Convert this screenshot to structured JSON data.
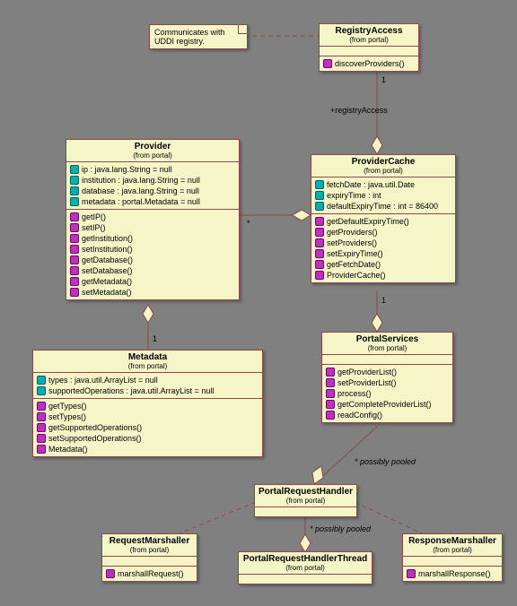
{
  "note": {
    "line1": "Communicates with",
    "line2": "UDDI registry."
  },
  "registryAccess": {
    "name": "RegistryAccess",
    "from": "(from portal)",
    "ops": [
      "discoverProviders()"
    ]
  },
  "provider": {
    "name": "Provider",
    "from": "(from portal)",
    "attrs": [
      "ip : java.lang.String = null",
      "institution : java.lang.String = null",
      "database : java.lang.String = null",
      "metadata : portal.Metadata = null"
    ],
    "ops": [
      "getIP()",
      "setIP()",
      "getInstitution()",
      "setInstitution()",
      "getDatabase()",
      "setDatabase()",
      "getMetadata()",
      "setMetadata()"
    ]
  },
  "providerCache": {
    "name": "ProviderCache",
    "from": "(from portal)",
    "attrs": [
      "fetchDate : java.util.Date",
      "expiryTime : int",
      "defaultExpiryTime : int = 86400"
    ],
    "ops": [
      "getDefaultExpiryTime()",
      "getProviders()",
      "setProviders()",
      "setExpiryTime()",
      "getFetchDate()",
      "ProviderCache()"
    ]
  },
  "metadata": {
    "name": "Metadata",
    "from": "(from portal)",
    "attrs": [
      "types : java.util.ArrayList = null",
      "supportedOperations : java.util.ArrayList = null"
    ],
    "ops": [
      "getTypes()",
      "setTypes()",
      "getSupportedOperations()",
      "setSupportedOperations()",
      "Metadata()"
    ]
  },
  "portalServices": {
    "name": "PortalServices",
    "from": "(from portal)",
    "ops": [
      "getProviderList()",
      "setProviderList()",
      "process()",
      "getCompleteProviderList()",
      "readConfig()"
    ]
  },
  "portalRequestHandler": {
    "name": "PortalRequestHandler",
    "from": "(from portal)"
  },
  "requestMarshaller": {
    "name": "RequestMarshaller",
    "from": "(from portal)",
    "ops": [
      "marshallRequest()"
    ]
  },
  "responseMarshaller": {
    "name": "ResponseMarshaller",
    "from": "(from portal)",
    "ops": [
      "marshallResponse()"
    ]
  },
  "portalRequestHandlerThread": {
    "name": "PortalRequestHandlerThread",
    "from": "(from portal)"
  },
  "labels": {
    "registryAccess": "+registryAccess",
    "one_a": "1",
    "star": "*",
    "one_b": "1",
    "one_c": "1",
    "pooled1": "*  possibly pooled",
    "pooled2": "*  possibly pooled"
  },
  "chart_data": {
    "type": "table",
    "title": "UML Class Diagram — portal package",
    "classes": [
      {
        "name": "RegistryAccess",
        "package": "portal",
        "operations": [
          "discoverProviders()"
        ]
      },
      {
        "name": "Provider",
        "package": "portal",
        "attributes": [
          "ip : java.lang.String = null",
          "institution : java.lang.String = null",
          "database : java.lang.String = null",
          "metadata : portal.Metadata = null"
        ],
        "operations": [
          "getIP()",
          "setIP()",
          "getInstitution()",
          "setInstitution()",
          "getDatabase()",
          "setDatabase()",
          "getMetadata()",
          "setMetadata()"
        ]
      },
      {
        "name": "ProviderCache",
        "package": "portal",
        "attributes": [
          "fetchDate : java.util.Date",
          "expiryTime : int",
          "defaultExpiryTime : int = 86400"
        ],
        "operations": [
          "getDefaultExpiryTime()",
          "getProviders()",
          "setProviders()",
          "setExpiryTime()",
          "getFetchDate()",
          "ProviderCache()"
        ]
      },
      {
        "name": "Metadata",
        "package": "portal",
        "attributes": [
          "types : java.util.ArrayList = null",
          "supportedOperations : java.util.ArrayList = null"
        ],
        "operations": [
          "getTypes()",
          "setTypes()",
          "getSupportedOperations()",
          "setSupportedOperations()",
          "Metadata()"
        ]
      },
      {
        "name": "PortalServices",
        "package": "portal",
        "operations": [
          "getProviderList()",
          "setProviderList()",
          "process()",
          "getCompleteProviderList()",
          "readConfig()"
        ]
      },
      {
        "name": "PortalRequestHandler",
        "package": "portal"
      },
      {
        "name": "RequestMarshaller",
        "package": "portal",
        "operations": [
          "marshallRequest()"
        ]
      },
      {
        "name": "ResponseMarshaller",
        "package": "portal",
        "operations": [
          "marshallResponse()"
        ]
      },
      {
        "name": "PortalRequestHandlerThread",
        "package": "portal"
      }
    ],
    "relationships": [
      {
        "from": "note",
        "to": "RegistryAccess",
        "type": "note-anchor"
      },
      {
        "from": "ProviderCache",
        "to": "RegistryAccess",
        "type": "aggregation",
        "role": "+registryAccess",
        "multiplicity": "1"
      },
      {
        "from": "ProviderCache",
        "to": "Provider",
        "type": "aggregation",
        "multiplicity": "*"
      },
      {
        "from": "Provider",
        "to": "Metadata",
        "type": "aggregation",
        "multiplicity": "1"
      },
      {
        "from": "PortalServices",
        "to": "ProviderCache",
        "type": "aggregation",
        "multiplicity": "1"
      },
      {
        "from": "PortalRequestHandler",
        "to": "PortalServices",
        "type": "aggregation",
        "constraint": "possibly pooled",
        "multiplicity": "*"
      },
      {
        "from": "PortalRequestHandler",
        "to": "RequestMarshaller",
        "type": "dependency"
      },
      {
        "from": "PortalRequestHandler",
        "to": "ResponseMarshaller",
        "type": "dependency"
      },
      {
        "from": "PortalRequestHandlerThread",
        "to": "PortalRequestHandler",
        "type": "aggregation",
        "constraint": "possibly pooled",
        "multiplicity": "*"
      }
    ]
  }
}
